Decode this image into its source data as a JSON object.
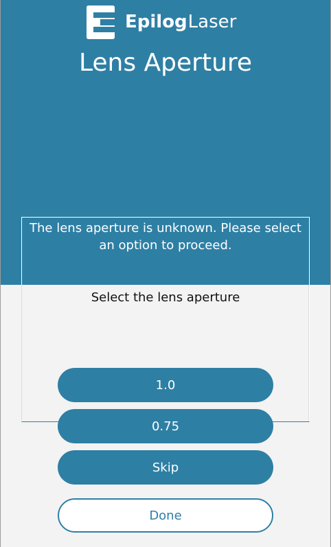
{
  "brand": {
    "name_bold": "Epilog",
    "name_light": "Laser",
    "accent_color": "#2e7fa4"
  },
  "page": {
    "title": "Lens Aperture"
  },
  "dialog": {
    "message": "The lens aperture is unknown. Please select an option to proceed.",
    "prompt": "Select the lens aperture"
  },
  "options": [
    {
      "label": "1.0"
    },
    {
      "label": "0.75"
    },
    {
      "label": "Skip"
    }
  ],
  "done_label": "Done"
}
